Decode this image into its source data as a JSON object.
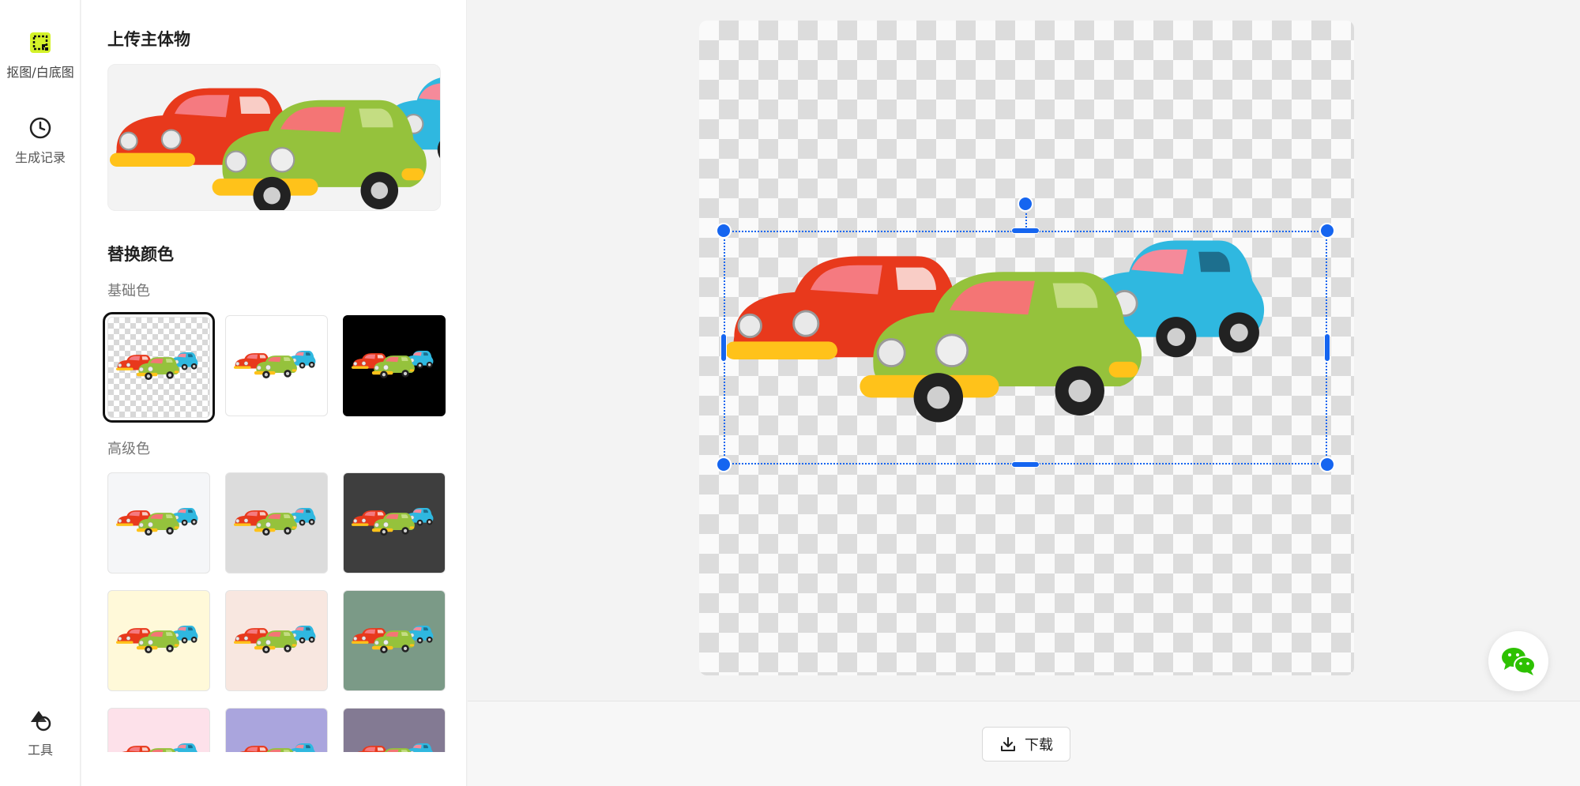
{
  "sidebar": {
    "items": [
      {
        "label": "抠图/白底图",
        "icon": "cutout-icon",
        "active": true
      },
      {
        "label": "生成记录",
        "icon": "clock-icon",
        "active": false
      },
      {
        "label": "工具",
        "icon": "shapes-icon",
        "active": false
      }
    ]
  },
  "panel": {
    "upload_title": "上传主体物",
    "replace_title": "替换颜色",
    "basic_label": "基础色",
    "advanced_label": "高级色",
    "basic_colors": [
      "transparent",
      "#ffffff",
      "#000000"
    ],
    "advanced_colors": [
      "#f5f6f8",
      "#dcdcdc",
      "#3e3e3e",
      "#fff9d9",
      "#f8e7e0",
      "#7b9a87",
      "#fde1ea",
      "#aaa5dd",
      "#837a93"
    ],
    "selected_basic_index": 0
  },
  "canvas": {
    "background": "transparent-checker",
    "subject": "three toy cars (red, green, blue)"
  },
  "bottom": {
    "download_label": "下载"
  },
  "colors": {
    "accent": "#1565f0",
    "active_icon": "#d4f229",
    "wechat": "#2dc100"
  }
}
